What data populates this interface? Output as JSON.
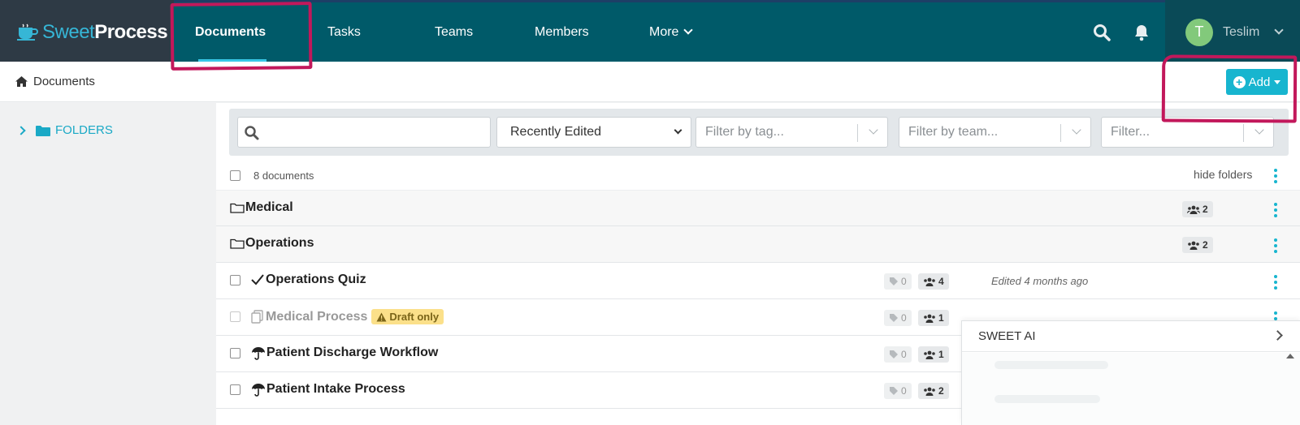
{
  "brand": {
    "name_part1": "Sweet",
    "name_part2": "Process"
  },
  "nav": {
    "items": [
      {
        "label": "Documents",
        "active": true
      },
      {
        "label": "Tasks"
      },
      {
        "label": "Teams"
      },
      {
        "label": "Members"
      },
      {
        "label": "More"
      }
    ]
  },
  "user": {
    "initial": "T",
    "name": "Teslim"
  },
  "breadcrumb": {
    "label": "Documents"
  },
  "add_button": {
    "label": "Add"
  },
  "sidebar": {
    "folders_label": "FOLDERS"
  },
  "filters": {
    "search_placeholder": "",
    "sort_value": "Recently Edited",
    "tag_placeholder": "Filter by tag...",
    "team_placeholder": "Filter by team...",
    "filter_placeholder": "Filter..."
  },
  "list": {
    "count_label": "8 documents",
    "hide_folders_label": "hide folders",
    "folders": [
      {
        "name": "Medical",
        "members": "2"
      },
      {
        "name": "Operations",
        "members": "2"
      }
    ],
    "documents": [
      {
        "icon": "checkmark-icon",
        "title": "Operations Quiz",
        "tags": "0",
        "members": "4",
        "edited": "Edited 4 months ago",
        "draft": false
      },
      {
        "icon": "copy-document-icon",
        "title": "Medical Process",
        "tags": "0",
        "members": "1",
        "edited": "",
        "draft": true,
        "draft_label": "Draft only"
      },
      {
        "icon": "umbrella-icon",
        "title": "Patient Discharge Workflow",
        "tags": "0",
        "members": "1",
        "edited": "",
        "draft": false
      },
      {
        "icon": "umbrella-icon",
        "title": "Patient Intake Process",
        "tags": "0",
        "members": "2",
        "edited": "",
        "draft": false
      }
    ]
  },
  "sweet_ai": {
    "title": "SWEET AI"
  },
  "colors": {
    "nav_bg": "#005a69",
    "brand_bg": "#2e3a45",
    "accent": "#17b5cf",
    "annotation": "#c2185b",
    "draft_badge": "#fbe08a"
  }
}
